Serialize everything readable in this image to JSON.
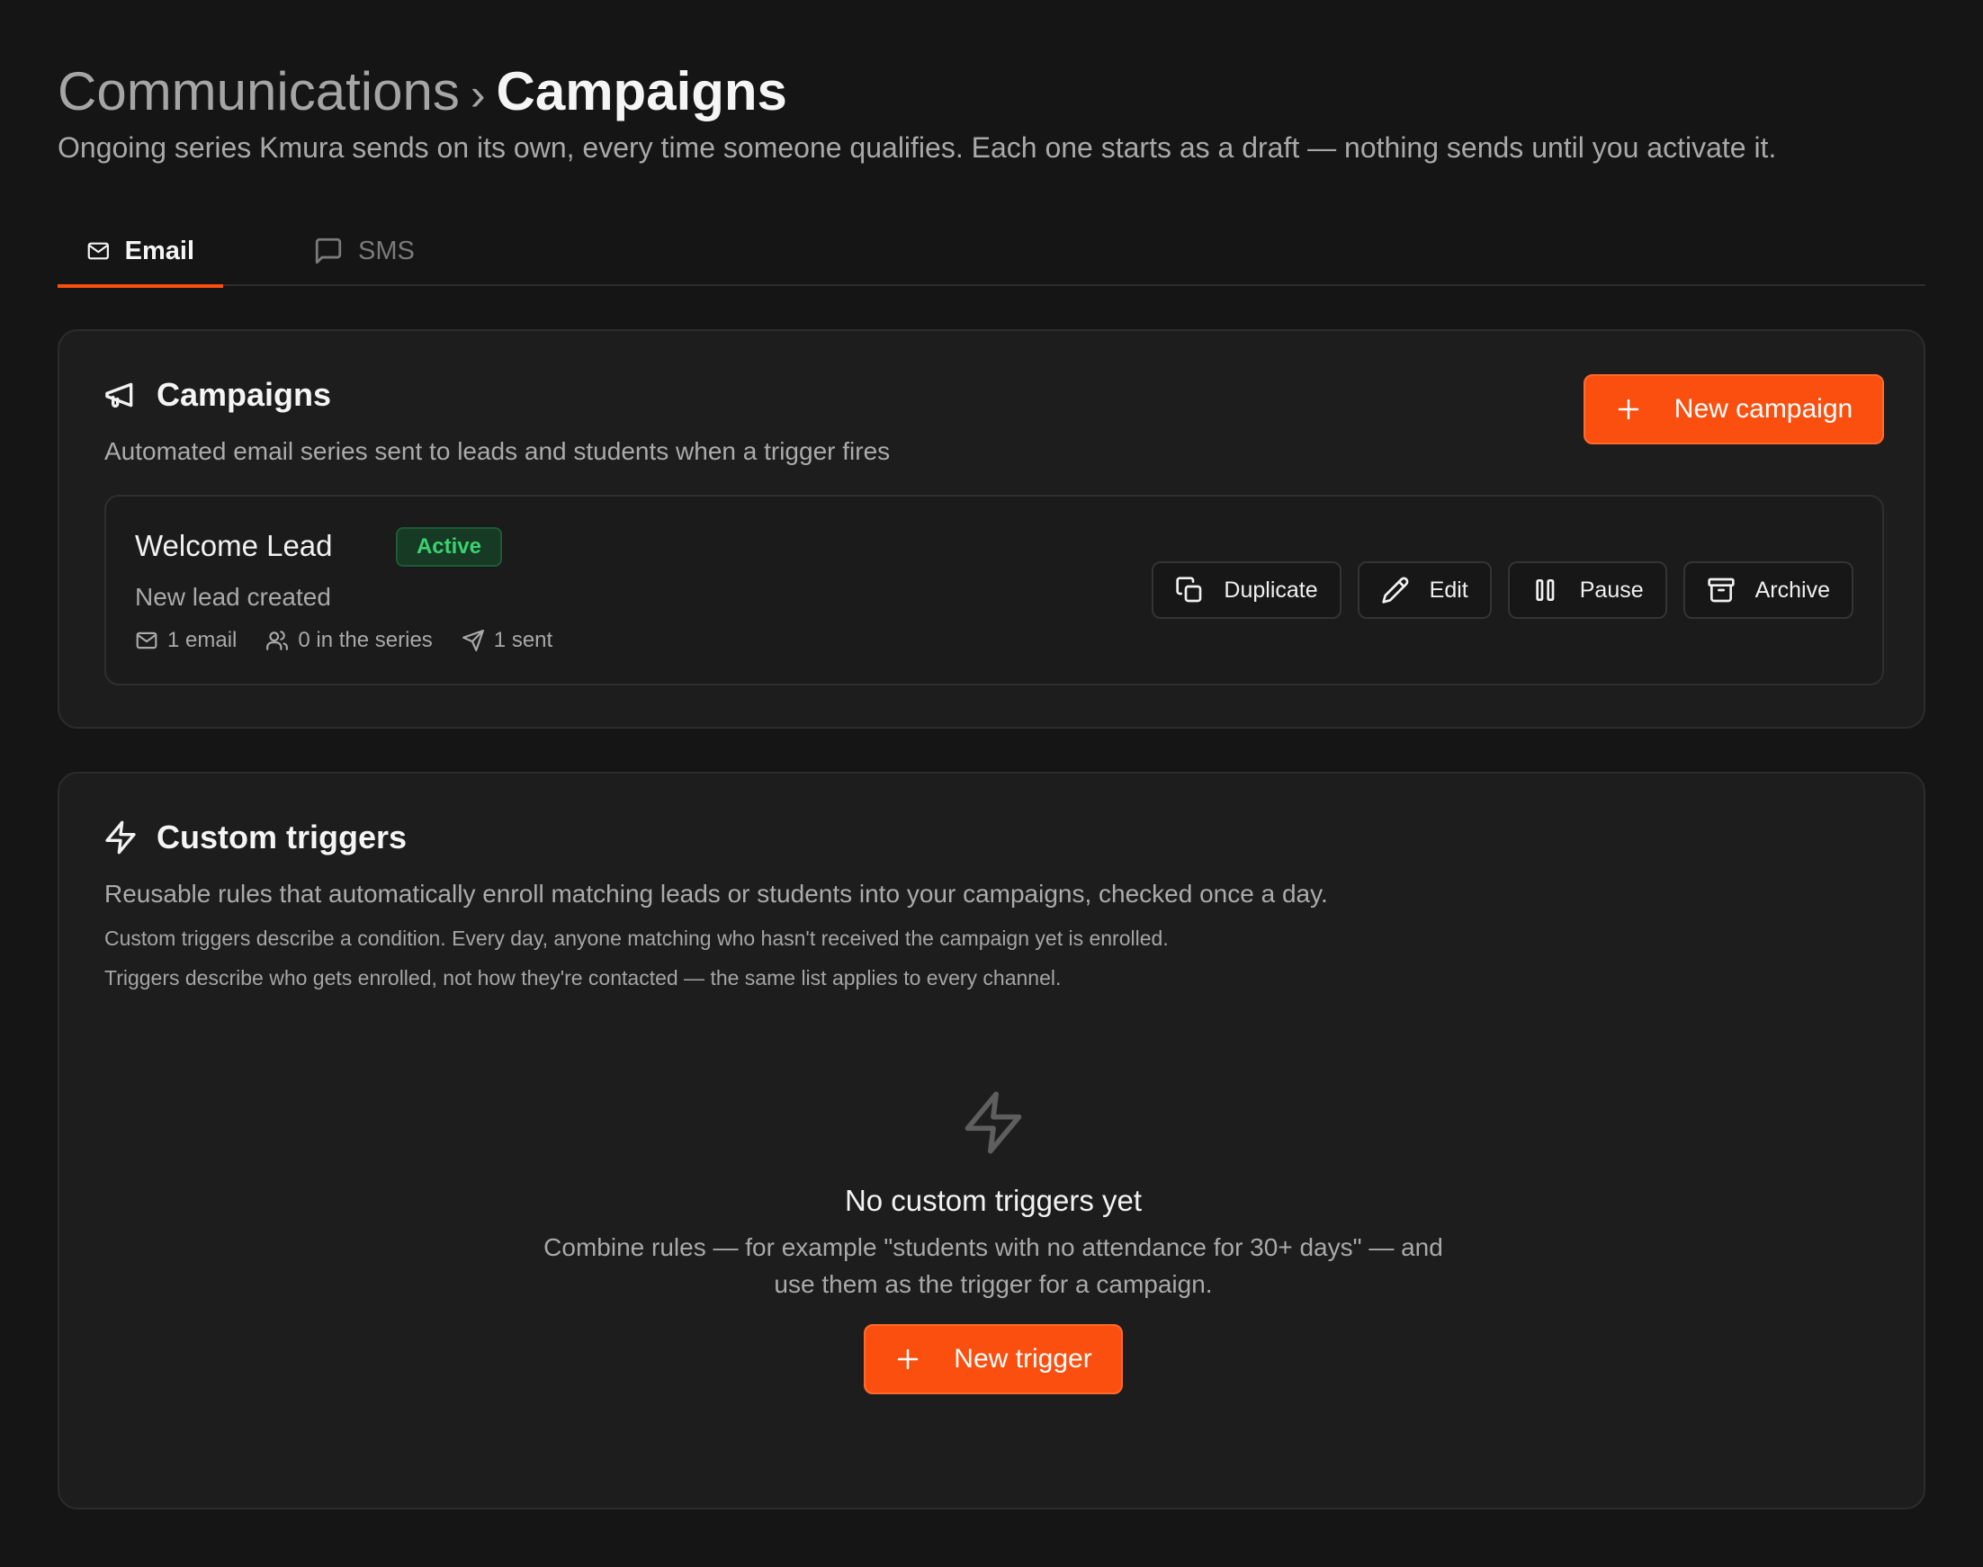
{
  "header": {
    "breadcrumb_parent": "Communications",
    "breadcrumb_separator": "›",
    "title": "Campaigns",
    "description": "Ongoing series Kmura sends on its own, every time someone qualifies. Each one starts as a draft — nothing sends until you activate it."
  },
  "tabs": [
    {
      "label": "Email",
      "icon": "mail-icon",
      "active": true
    },
    {
      "label": "SMS",
      "icon": "message-square-icon",
      "active": false
    }
  ],
  "campaigns_card": {
    "title": "Campaigns",
    "icon": "megaphone-icon",
    "description": "Automated email series sent to leads and students when a trigger fires",
    "new_button": "New campaign",
    "items": [
      {
        "name": "Welcome Lead",
        "status": "Active",
        "trigger": "New lead created",
        "stats": {
          "emails": "1 email",
          "in_series": "0 in the series",
          "sent": "1 sent"
        },
        "actions": {
          "duplicate": "Duplicate",
          "edit": "Edit",
          "pause": "Pause",
          "archive": "Archive"
        }
      }
    ]
  },
  "triggers_card": {
    "title": "Custom triggers",
    "icon": "zap-icon",
    "description": "Reusable rules that automatically enroll matching leads or students into your campaigns, checked once a day.",
    "note_1": "Custom triggers describe a condition. Every day, anyone matching who hasn't received the campaign yet is enrolled.",
    "note_2": "Triggers describe who gets enrolled, not how they're contacted — the same list applies to every channel.",
    "empty": {
      "title": "No custom triggers yet",
      "description": "Combine rules — for example \"students with no attendance for 30+ days\" — and use them as the trigger for a campaign.",
      "button": "New trigger"
    }
  },
  "colors": {
    "accent": "#fb4f0f",
    "background": "#151515",
    "card": "#1d1d1d",
    "status_active": "#3bd16f"
  }
}
